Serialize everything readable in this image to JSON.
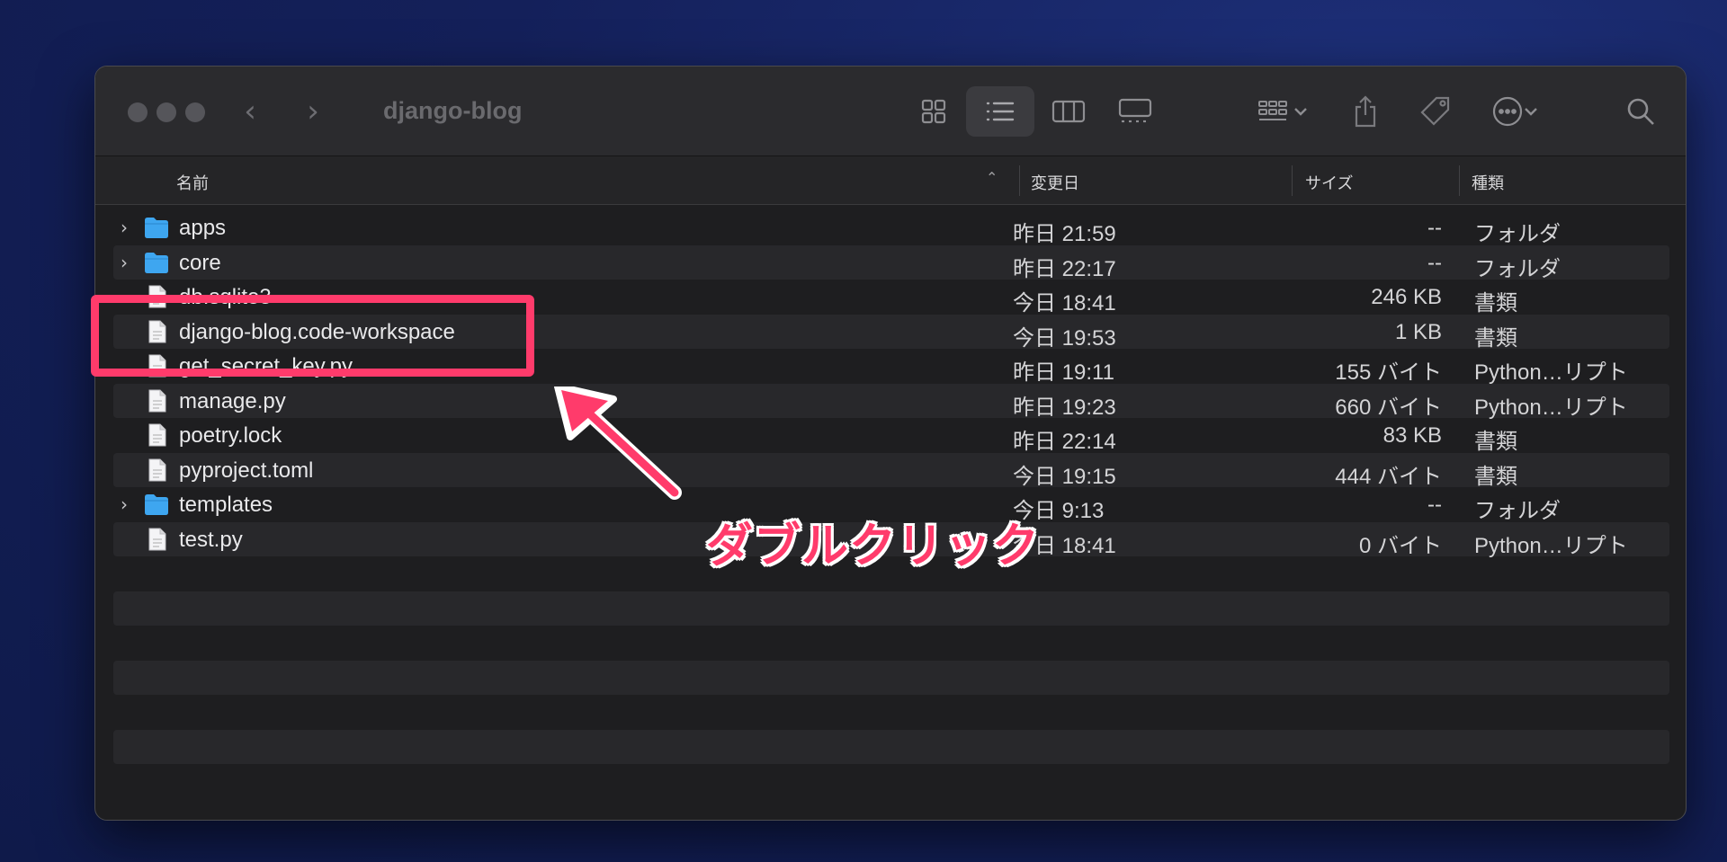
{
  "window": {
    "title": "django-blog",
    "toolbar_icons": [
      "icon-view-grid-icon",
      "list-view-icon",
      "column-view-icon",
      "gallery-view-icon",
      "group-icon",
      "share-icon",
      "tag-icon",
      "more-icon",
      "search-icon"
    ]
  },
  "columns": {
    "name": "名前",
    "modified": "変更日",
    "size": "サイズ",
    "kind": "種類"
  },
  "files": [
    {
      "name": "apps",
      "date": "昨日 21:59",
      "size": "--",
      "kind": "フォルダ",
      "icon": "folder-icon",
      "folder": true
    },
    {
      "name": "core",
      "date": "昨日 22:17",
      "size": "--",
      "kind": "フォルダ",
      "icon": "folder-icon",
      "folder": true
    },
    {
      "name": "db.sqlite3",
      "date": "今日 18:41",
      "size": "246 KB",
      "kind": "書類",
      "icon": "document-icon",
      "folder": false
    },
    {
      "name": "django-blog.code-workspace",
      "date": "今日 19:53",
      "size": "1 KB",
      "kind": "書類",
      "icon": "document-icon",
      "folder": false
    },
    {
      "name": "get_secret_key.py",
      "date": "昨日 19:11",
      "size": "155 バイト",
      "kind": "Python…リプト",
      "icon": "python-file-icon",
      "folder": false
    },
    {
      "name": "manage.py",
      "date": "昨日 19:23",
      "size": "660 バイト",
      "kind": "Python…リプト",
      "icon": "python-file-icon",
      "folder": false
    },
    {
      "name": "poetry.lock",
      "date": "昨日 22:14",
      "size": "83 KB",
      "kind": "書類",
      "icon": "document-icon",
      "folder": false
    },
    {
      "name": "pyproject.toml",
      "date": "今日 19:15",
      "size": "444 バイト",
      "kind": "書類",
      "icon": "document-icon",
      "folder": false
    },
    {
      "name": "templates",
      "date": "今日 9:13",
      "size": "--",
      "kind": "フォルダ",
      "icon": "folder-icon",
      "folder": true
    },
    {
      "name": "test.py",
      "date": "今日 18:41",
      "size": "0 バイト",
      "kind": "Python…リプト",
      "icon": "python-file-icon",
      "folder": false
    }
  ],
  "annotation": {
    "callout_text": "ダブルクリック",
    "color": "#ff3b6b"
  },
  "colors": {
    "folder": "#3ea6f0",
    "accent": "#ff3b6b"
  }
}
